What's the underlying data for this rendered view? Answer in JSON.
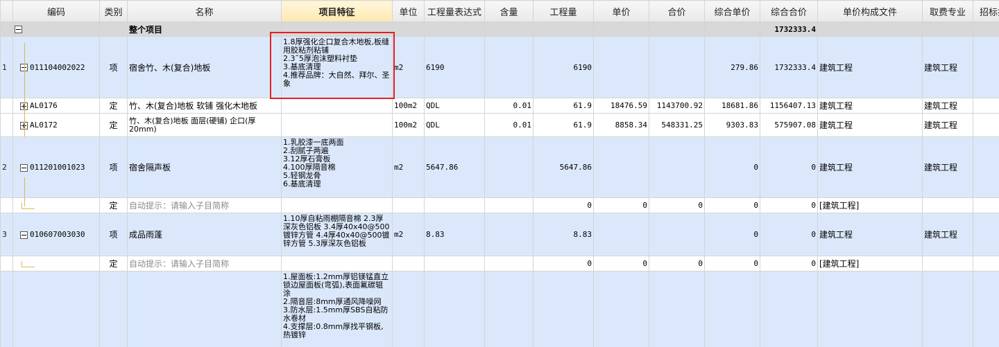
{
  "headers": [
    "编码",
    "类别",
    "名称",
    "项目特征",
    "单位",
    "工程量表达式",
    "含量",
    "工程量",
    "单价",
    "合价",
    "综合单价",
    "综合合价",
    "单价构成文件",
    "取费专业",
    "招标控"
  ],
  "summary": {
    "name": "整个项目",
    "total": "1732333.4"
  },
  "rows": [
    {
      "no": "1",
      "code": "011104002022",
      "type": "项",
      "name": "宿舍竹、木(复合)地板",
      "feature": [
        "1.8厚强化企口复合木地板,板缝用胶粘剂粘铺",
        "2.3˜5厚泡沫塑料衬垫",
        "3.基底清理",
        "4.推荐品牌：大自然、拜尔、圣象"
      ],
      "unit": "m2",
      "expr": "6190",
      "content": "",
      "qty": "6190",
      "price": "",
      "amount": "",
      "cprice": "279.86",
      "camount": "1732333.4",
      "file": "建筑工程",
      "fee": "建筑工程"
    },
    {
      "no": "",
      "code": "AL0176",
      "type": "定",
      "name": "竹、木(复合)地板 软铺 强化木地板",
      "feature": [],
      "unit": "100m2",
      "expr": "QDL",
      "content": "0.01",
      "qty": "61.9",
      "price": "18476.59",
      "amount": "1143700.92",
      "cprice": "18681.86",
      "camount": "1156407.13",
      "file": "建筑工程",
      "fee": "建筑工程"
    },
    {
      "no": "",
      "code": "AL0172",
      "type": "定",
      "name": "竹、木(复合)地板 面层(硬铺) 企口(厚20mm)",
      "feature": [],
      "unit": "100m2",
      "expr": "QDL",
      "content": "0.01",
      "qty": "61.9",
      "price": "8858.34",
      "amount": "548331.25",
      "cprice": "9303.83",
      "camount": "575907.08",
      "file": "建筑工程",
      "fee": "建筑工程"
    },
    {
      "no": "2",
      "code": "011201001023",
      "type": "项",
      "name": "宿舍隔声板",
      "feature": [
        "1.乳胶漆一底两面",
        "2.刮腻子两遍",
        "3.12厚石膏板",
        "4.100厚隔音棉",
        "5.轻钢龙骨",
        "6.基底清理"
      ],
      "unit": "m2",
      "expr": "5647.86",
      "content": "",
      "qty": "5647.86",
      "price": "",
      "amount": "",
      "cprice": "0",
      "camount": "0",
      "file": "建筑工程",
      "fee": "建筑工程"
    },
    {
      "no": "",
      "code": "",
      "type": "定",
      "name": "自动提示：请输入子目简称",
      "feature": [],
      "unit": "",
      "expr": "",
      "content": "",
      "qty": "0",
      "price": "0",
      "amount": "0",
      "cprice": "0",
      "camount": "0",
      "file": "[建筑工程]",
      "fee": ""
    },
    {
      "no": "3",
      "code": "010607003030",
      "type": "项",
      "name": "成品雨蓬",
      "feature": [
        "1.10厚自粘雨棚隔音棉 2.3厚深灰色铝板 3.4厚40x40@500镀锌方管 4.4厚40x40@500镀锌方管 5.3厚深灰色铝板"
      ],
      "unit": "m2",
      "expr": "8.83",
      "content": "",
      "qty": "8.83",
      "price": "",
      "amount": "",
      "cprice": "0",
      "camount": "0",
      "file": "建筑工程",
      "fee": "建筑工程"
    },
    {
      "no": "",
      "code": "",
      "type": "定",
      "name": "自动提示：请输入子目简称",
      "feature": [],
      "unit": "",
      "expr": "",
      "content": "",
      "qty": "0",
      "price": "0",
      "amount": "0",
      "cprice": "0",
      "camount": "0",
      "file": "[建筑工程]",
      "fee": ""
    },
    {
      "no": "",
      "code": "",
      "type": "",
      "name": "",
      "feature": [
        "1.屋面板:1.2mm厚铝镁锰直立锁边屋面板(弯弧),表面氟碳辊涂",
        "2.隔音层:8mm厚通风降噪网",
        "3.防水层:1.5mm厚SBS自粘防水卷材",
        "4.支撑层:0.8mm厚找平钢板,热镀锌"
      ],
      "unit": "",
      "expr": "",
      "content": "",
      "qty": "",
      "price": "",
      "amount": "",
      "cprice": "",
      "camount": "",
      "file": "",
      "fee": ""
    }
  ]
}
